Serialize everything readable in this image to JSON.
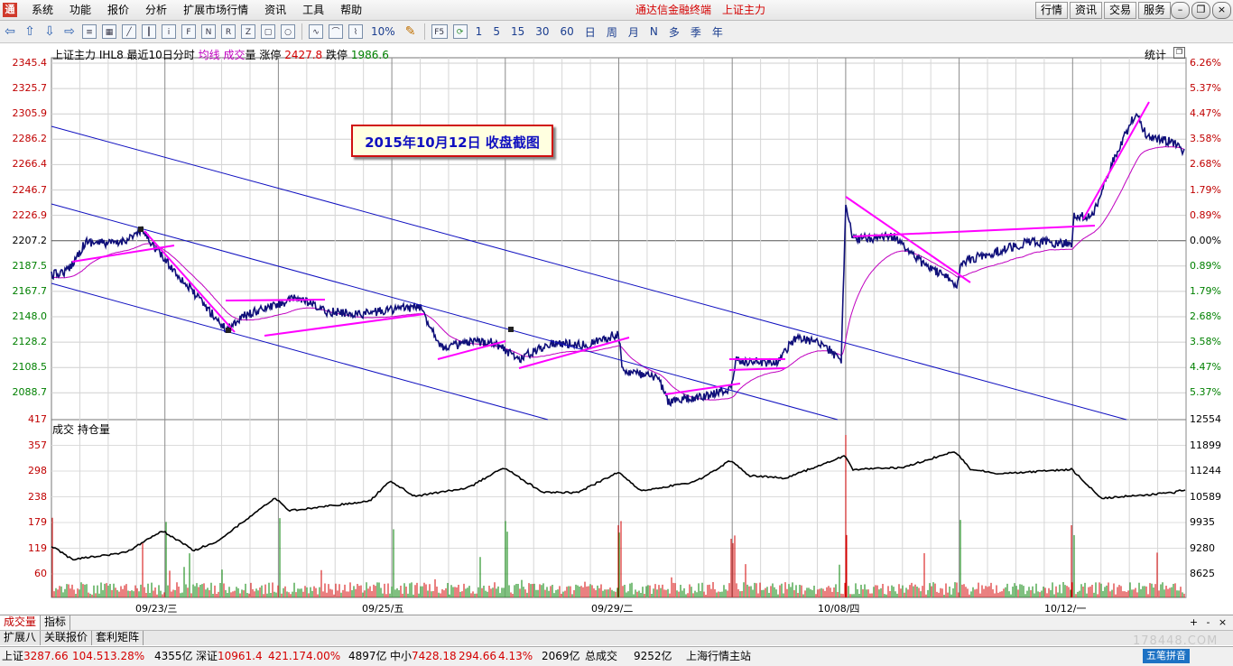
{
  "menubar": {
    "logo": "通",
    "items": [
      "系统",
      "功能",
      "报价",
      "分析",
      "扩展市场行情",
      "资讯",
      "工具",
      "帮助"
    ],
    "center_app": "通达信金融终端",
    "center_symbol": "上证主力",
    "right_buttons": [
      "行情",
      "资讯",
      "交易",
      "服务"
    ],
    "window_controls": [
      "minimize-icon",
      "restore-icon",
      "close-icon"
    ]
  },
  "toolbar": {
    "periods": [
      "1",
      "5",
      "15",
      "30",
      "60",
      "日",
      "周",
      "月",
      "N",
      "多",
      "季",
      "年"
    ],
    "percent_label": "10%",
    "f5_label": "F5"
  },
  "chart_header": {
    "name": "上证主力 IHL8",
    "period": "最近10日分时",
    "avg_label": "均线",
    "vol_label_a": "成交",
    "vol_label_b": "量",
    "limit_up_label": "涨停",
    "limit_up_value": "2427.8",
    "limit_down_label": "跌停",
    "limit_down_value": "1986.6",
    "stat_button": "统计"
  },
  "annotation": "2015年10月12日  收盘截图",
  "volume_panel": {
    "label": "成交 持仓量"
  },
  "price_axis_left": [
    "2345.4",
    "2325.7",
    "2305.9",
    "2286.2",
    "2266.4",
    "2246.7",
    "2226.9",
    "2207.2",
    "2187.5",
    "2167.7",
    "2148.0",
    "2128.2",
    "2108.5",
    "2088.7"
  ],
  "price_axis_right": [
    "6.26%",
    "5.37%",
    "4.47%",
    "3.58%",
    "2.68%",
    "1.79%",
    "0.89%",
    "0.00%",
    "0.89%",
    "1.79%",
    "2.68%",
    "3.58%",
    "4.47%",
    "5.37%"
  ],
  "vol_axis_left": [
    "417",
    "357",
    "298",
    "238",
    "179",
    "119",
    "60"
  ],
  "oi_axis_right": [
    "12554",
    "11899",
    "11244",
    "10589",
    "9935",
    "9280",
    "8625"
  ],
  "dates": [
    "09/23/三",
    "09/25/五",
    "09/29/二",
    "10/08/四",
    "10/12/一"
  ],
  "colors": {
    "up": "#d40000",
    "down": "#008000",
    "price_line": "#10107a",
    "avg_line": "#c000c0",
    "trend": "#ff00ff",
    "channel": "#1010c0"
  },
  "tabs_row1": [
    "成交量",
    "指标"
  ],
  "tabs_row2": [
    "扩展八",
    "关联报价",
    "套利矩阵"
  ],
  "zoom_buttons": [
    "+",
    "-",
    "×"
  ],
  "status": {
    "sh_label": "上证",
    "sh_value": "3287.66",
    "sh_change": "104.51",
    "sh_pct": "3.28%",
    "sh_amount": "4355亿",
    "sz_label": "深证",
    "sz_value": "10961.4",
    "sz_change": "421.17",
    "sz_pct": "4.00%",
    "sz_amount": "4897亿",
    "zx_label": "中小",
    "zx_value": "7428.18",
    "zx_change": "294.66",
    "zx_pct": "4.13%",
    "zx_amount": "2069亿",
    "total_label": "总成交",
    "total_value": "9252亿",
    "station": "上海行情主站"
  },
  "ime": "五笔拼音",
  "watermark": "178448.COM"
}
